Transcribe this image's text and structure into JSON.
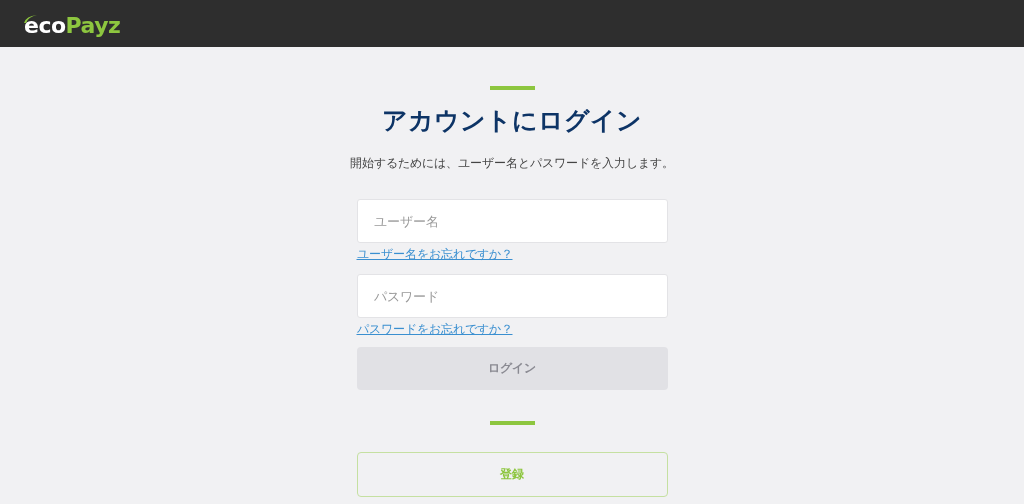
{
  "header": {
    "logo": {
      "part_1": "eco",
      "part_2": "Payz"
    }
  },
  "login": {
    "title": "アカウントにログイン",
    "subtitle": "開始するためには、ユーザー名とパスワードを入力します。",
    "fields": [
      {
        "placeholder": "ユーザー名",
        "link": "ユーザー名をお忘れですか？"
      },
      {
        "placeholder": "パスワード",
        "link": "パスワードをお忘れですか？"
      }
    ],
    "login_button": {
      "label": "ログイン",
      "disabled": true
    },
    "register_button": {
      "label": "登録"
    }
  }
}
